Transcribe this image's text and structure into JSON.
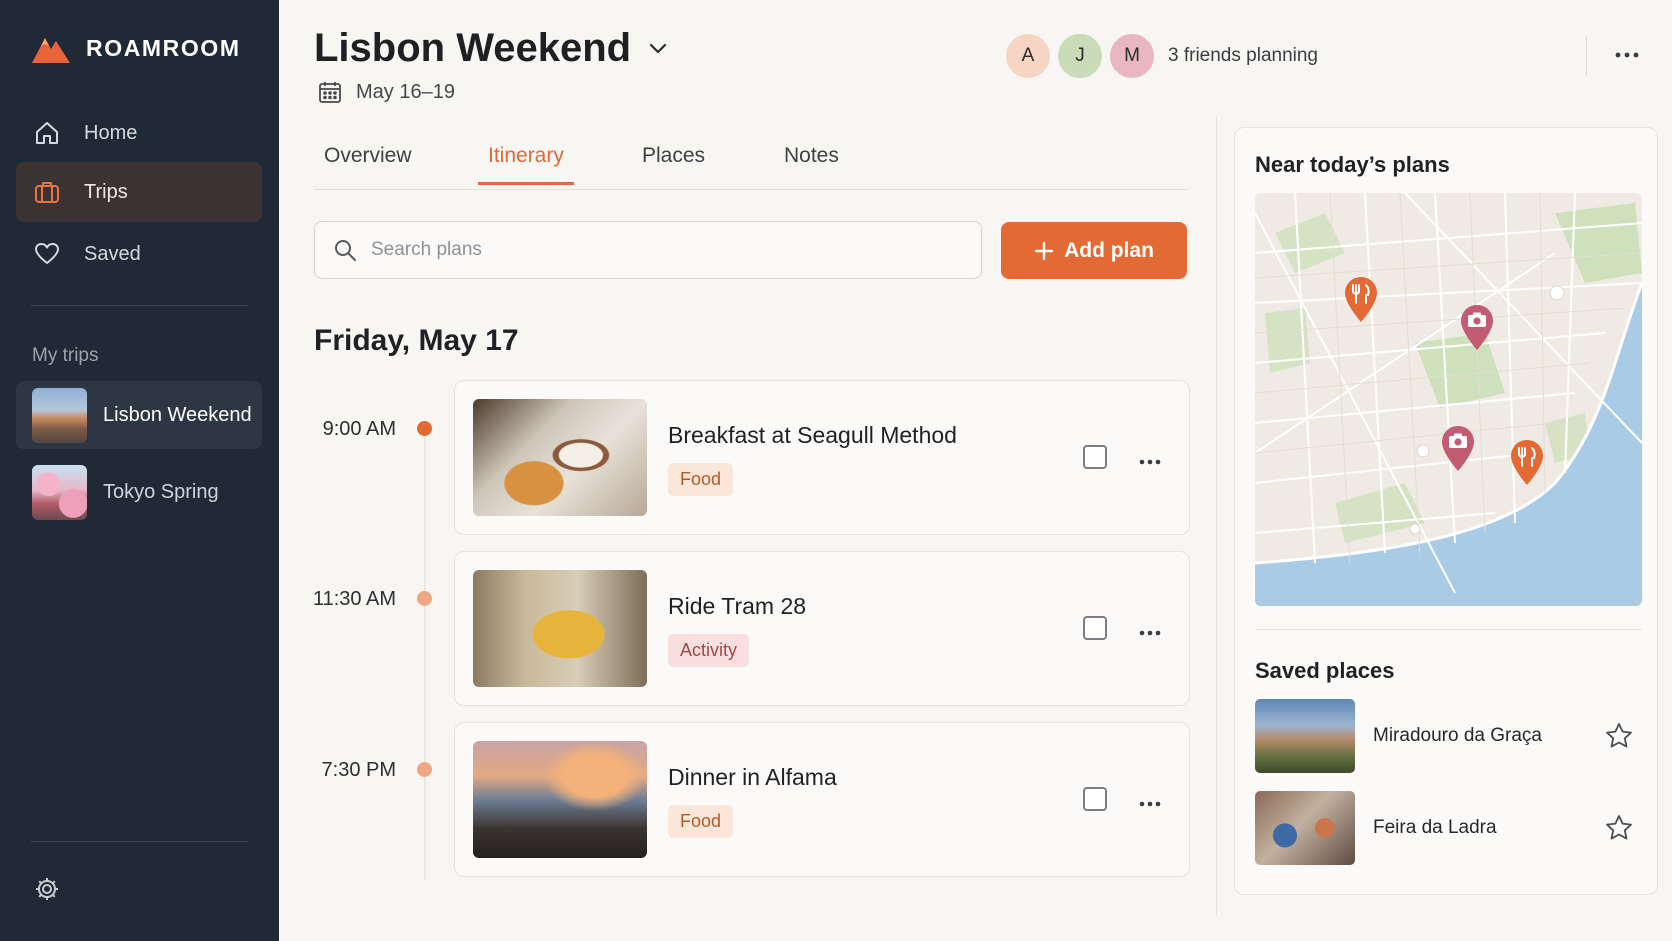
{
  "app": {
    "brand": "ROAMROOM",
    "accent": "#e36a34"
  },
  "sidebar": {
    "nav": [
      {
        "label": "Home",
        "icon": "home-icon"
      },
      {
        "label": "Trips",
        "icon": "suitcase-icon",
        "active": true
      },
      {
        "label": "Saved",
        "icon": "heart-icon"
      }
    ],
    "section_label": "My trips",
    "trips": [
      {
        "label": "Lisbon Weekend",
        "active": true
      },
      {
        "label": "Tokyo Spring"
      }
    ],
    "settings_icon": "gear-icon"
  },
  "header": {
    "title": "Lisbon Weekend",
    "dates": "May 16–19",
    "avatars": [
      {
        "initial": "A",
        "color": "#f6d5c4"
      },
      {
        "initial": "J",
        "color": "#c9dbb8"
      },
      {
        "initial": "M",
        "color": "#e8b7bf"
      }
    ],
    "friends_text": "3 friends planning"
  },
  "tabs": [
    {
      "label": "Overview"
    },
    {
      "label": "Itinerary",
      "active": true
    },
    {
      "label": "Places"
    },
    {
      "label": "Notes"
    }
  ],
  "search": {
    "placeholder": "Search plans",
    "value": ""
  },
  "add_button": {
    "label": "Add plan"
  },
  "day": {
    "heading": "Friday, May 17",
    "plans": [
      {
        "time": "9:00 AM",
        "name": "Breakfast at Seagull Method",
        "tag": "Food",
        "done": false
      },
      {
        "time": "11:30 AM",
        "name": "Ride Tram 28",
        "tag": "Activity",
        "done": false
      },
      {
        "time": "7:30 PM",
        "name": "Dinner in Alfama",
        "tag": "Food",
        "done": false
      }
    ]
  },
  "right_panel": {
    "map_title": "Near today’s plans",
    "map_pins": [
      "food-pin-icon",
      "camera-pin-icon",
      "camera-pin-icon",
      "food-pin-icon"
    ],
    "saved_title": "Saved places",
    "saved": [
      {
        "name": "Miradouro da Graça"
      },
      {
        "name": "Feira da Ladra"
      }
    ]
  }
}
